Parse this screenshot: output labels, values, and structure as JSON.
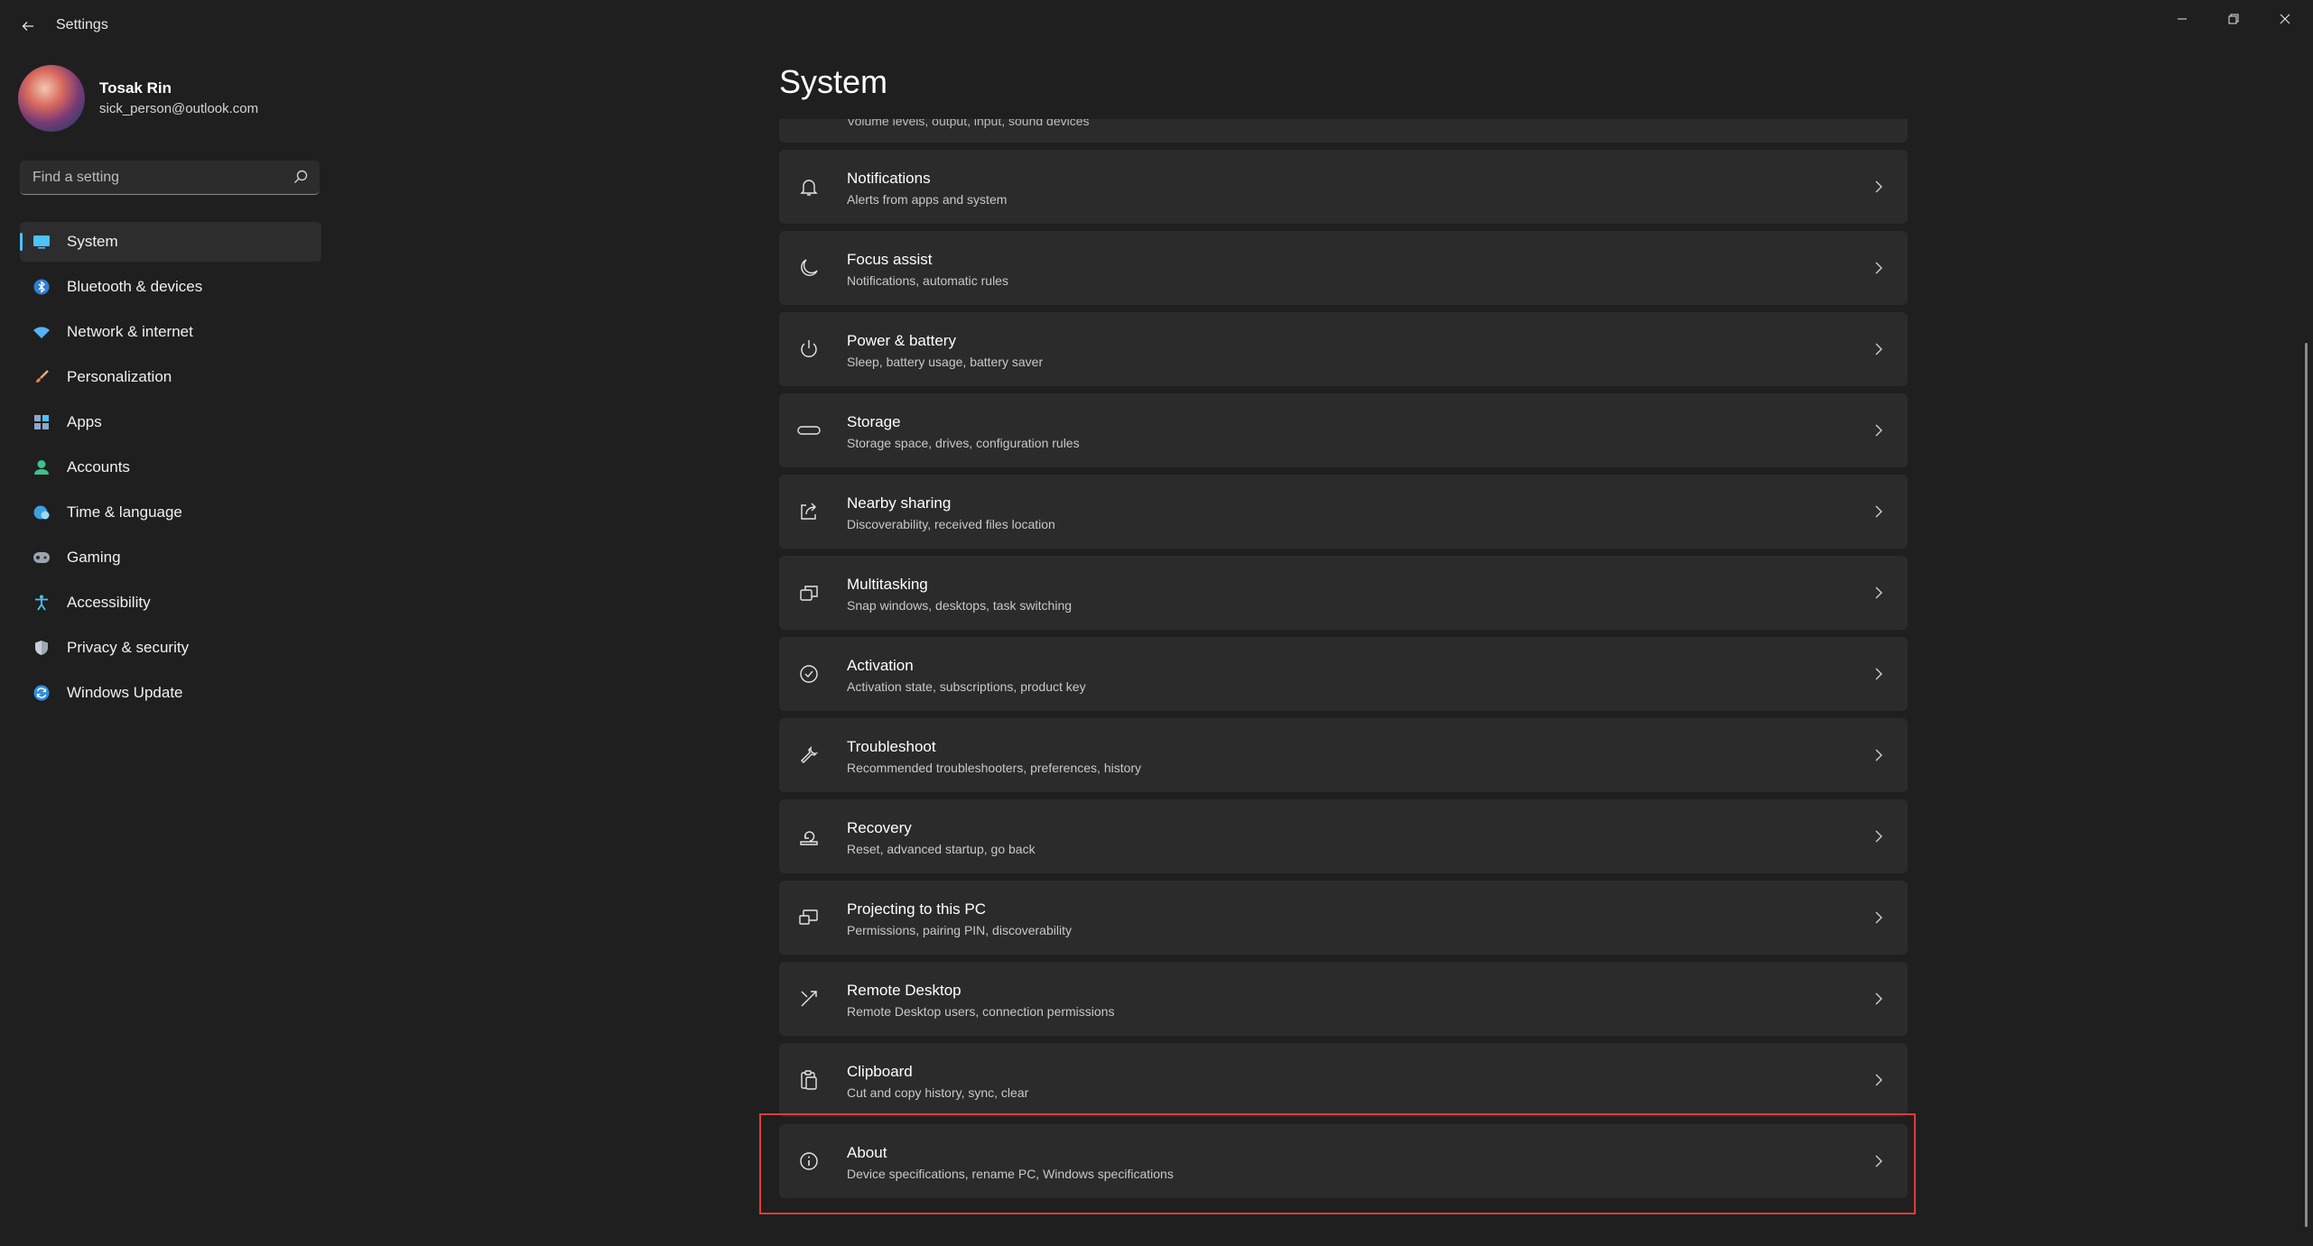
{
  "window": {
    "title": "Settings"
  },
  "profile": {
    "name": "Tosak Rin",
    "email": "sick_person@outlook.com"
  },
  "search": {
    "placeholder": "Find a setting"
  },
  "sidebar": {
    "items": [
      {
        "label": "System",
        "icon": "system-icon",
        "selected": true
      },
      {
        "label": "Bluetooth & devices",
        "icon": "bluetooth-icon"
      },
      {
        "label": "Network & internet",
        "icon": "wifi-icon"
      },
      {
        "label": "Personalization",
        "icon": "brush-icon"
      },
      {
        "label": "Apps",
        "icon": "apps-icon"
      },
      {
        "label": "Accounts",
        "icon": "account-icon"
      },
      {
        "label": "Time & language",
        "icon": "globe-clock-icon"
      },
      {
        "label": "Gaming",
        "icon": "gamepad-icon"
      },
      {
        "label": "Accessibility",
        "icon": "accessibility-icon"
      },
      {
        "label": "Privacy & security",
        "icon": "shield-icon"
      },
      {
        "label": "Windows Update",
        "icon": "update-icon"
      }
    ]
  },
  "main": {
    "title": "System",
    "partial_card": {
      "subtitle": "Volume levels, output, input, sound devices"
    },
    "cards": [
      {
        "title": "Notifications",
        "subtitle": "Alerts from apps and system",
        "icon": "bell-icon"
      },
      {
        "title": "Focus assist",
        "subtitle": "Notifications, automatic rules",
        "icon": "moon-icon"
      },
      {
        "title": "Power & battery",
        "subtitle": "Sleep, battery usage, battery saver",
        "icon": "power-icon"
      },
      {
        "title": "Storage",
        "subtitle": "Storage space, drives, configuration rules",
        "icon": "storage-icon"
      },
      {
        "title": "Nearby sharing",
        "subtitle": "Discoverability, received files location",
        "icon": "share-icon"
      },
      {
        "title": "Multitasking",
        "subtitle": "Snap windows, desktops, task switching",
        "icon": "multitask-icon"
      },
      {
        "title": "Activation",
        "subtitle": "Activation state, subscriptions, product key",
        "icon": "check-circle-icon"
      },
      {
        "title": "Troubleshoot",
        "subtitle": "Recommended troubleshooters, preferences, history",
        "icon": "wrench-icon"
      },
      {
        "title": "Recovery",
        "subtitle": "Reset, advanced startup, go back",
        "icon": "recovery-icon"
      },
      {
        "title": "Projecting to this PC",
        "subtitle": "Permissions, pairing PIN, discoverability",
        "icon": "projector-icon"
      },
      {
        "title": "Remote Desktop",
        "subtitle": "Remote Desktop users, connection permissions",
        "icon": "remote-desktop-icon"
      },
      {
        "title": "Clipboard",
        "subtitle": "Cut and copy history, sync, clear",
        "icon": "clipboard-icon"
      },
      {
        "title": "About",
        "subtitle": "Device specifications, rename PC, Windows specifications",
        "icon": "info-icon",
        "highlighted": true
      }
    ]
  },
  "colors": {
    "accent": "#4cc2ff",
    "highlight": "#e03b3b",
    "background": "#1f1f1f",
    "card": "#2b2b2b"
  }
}
